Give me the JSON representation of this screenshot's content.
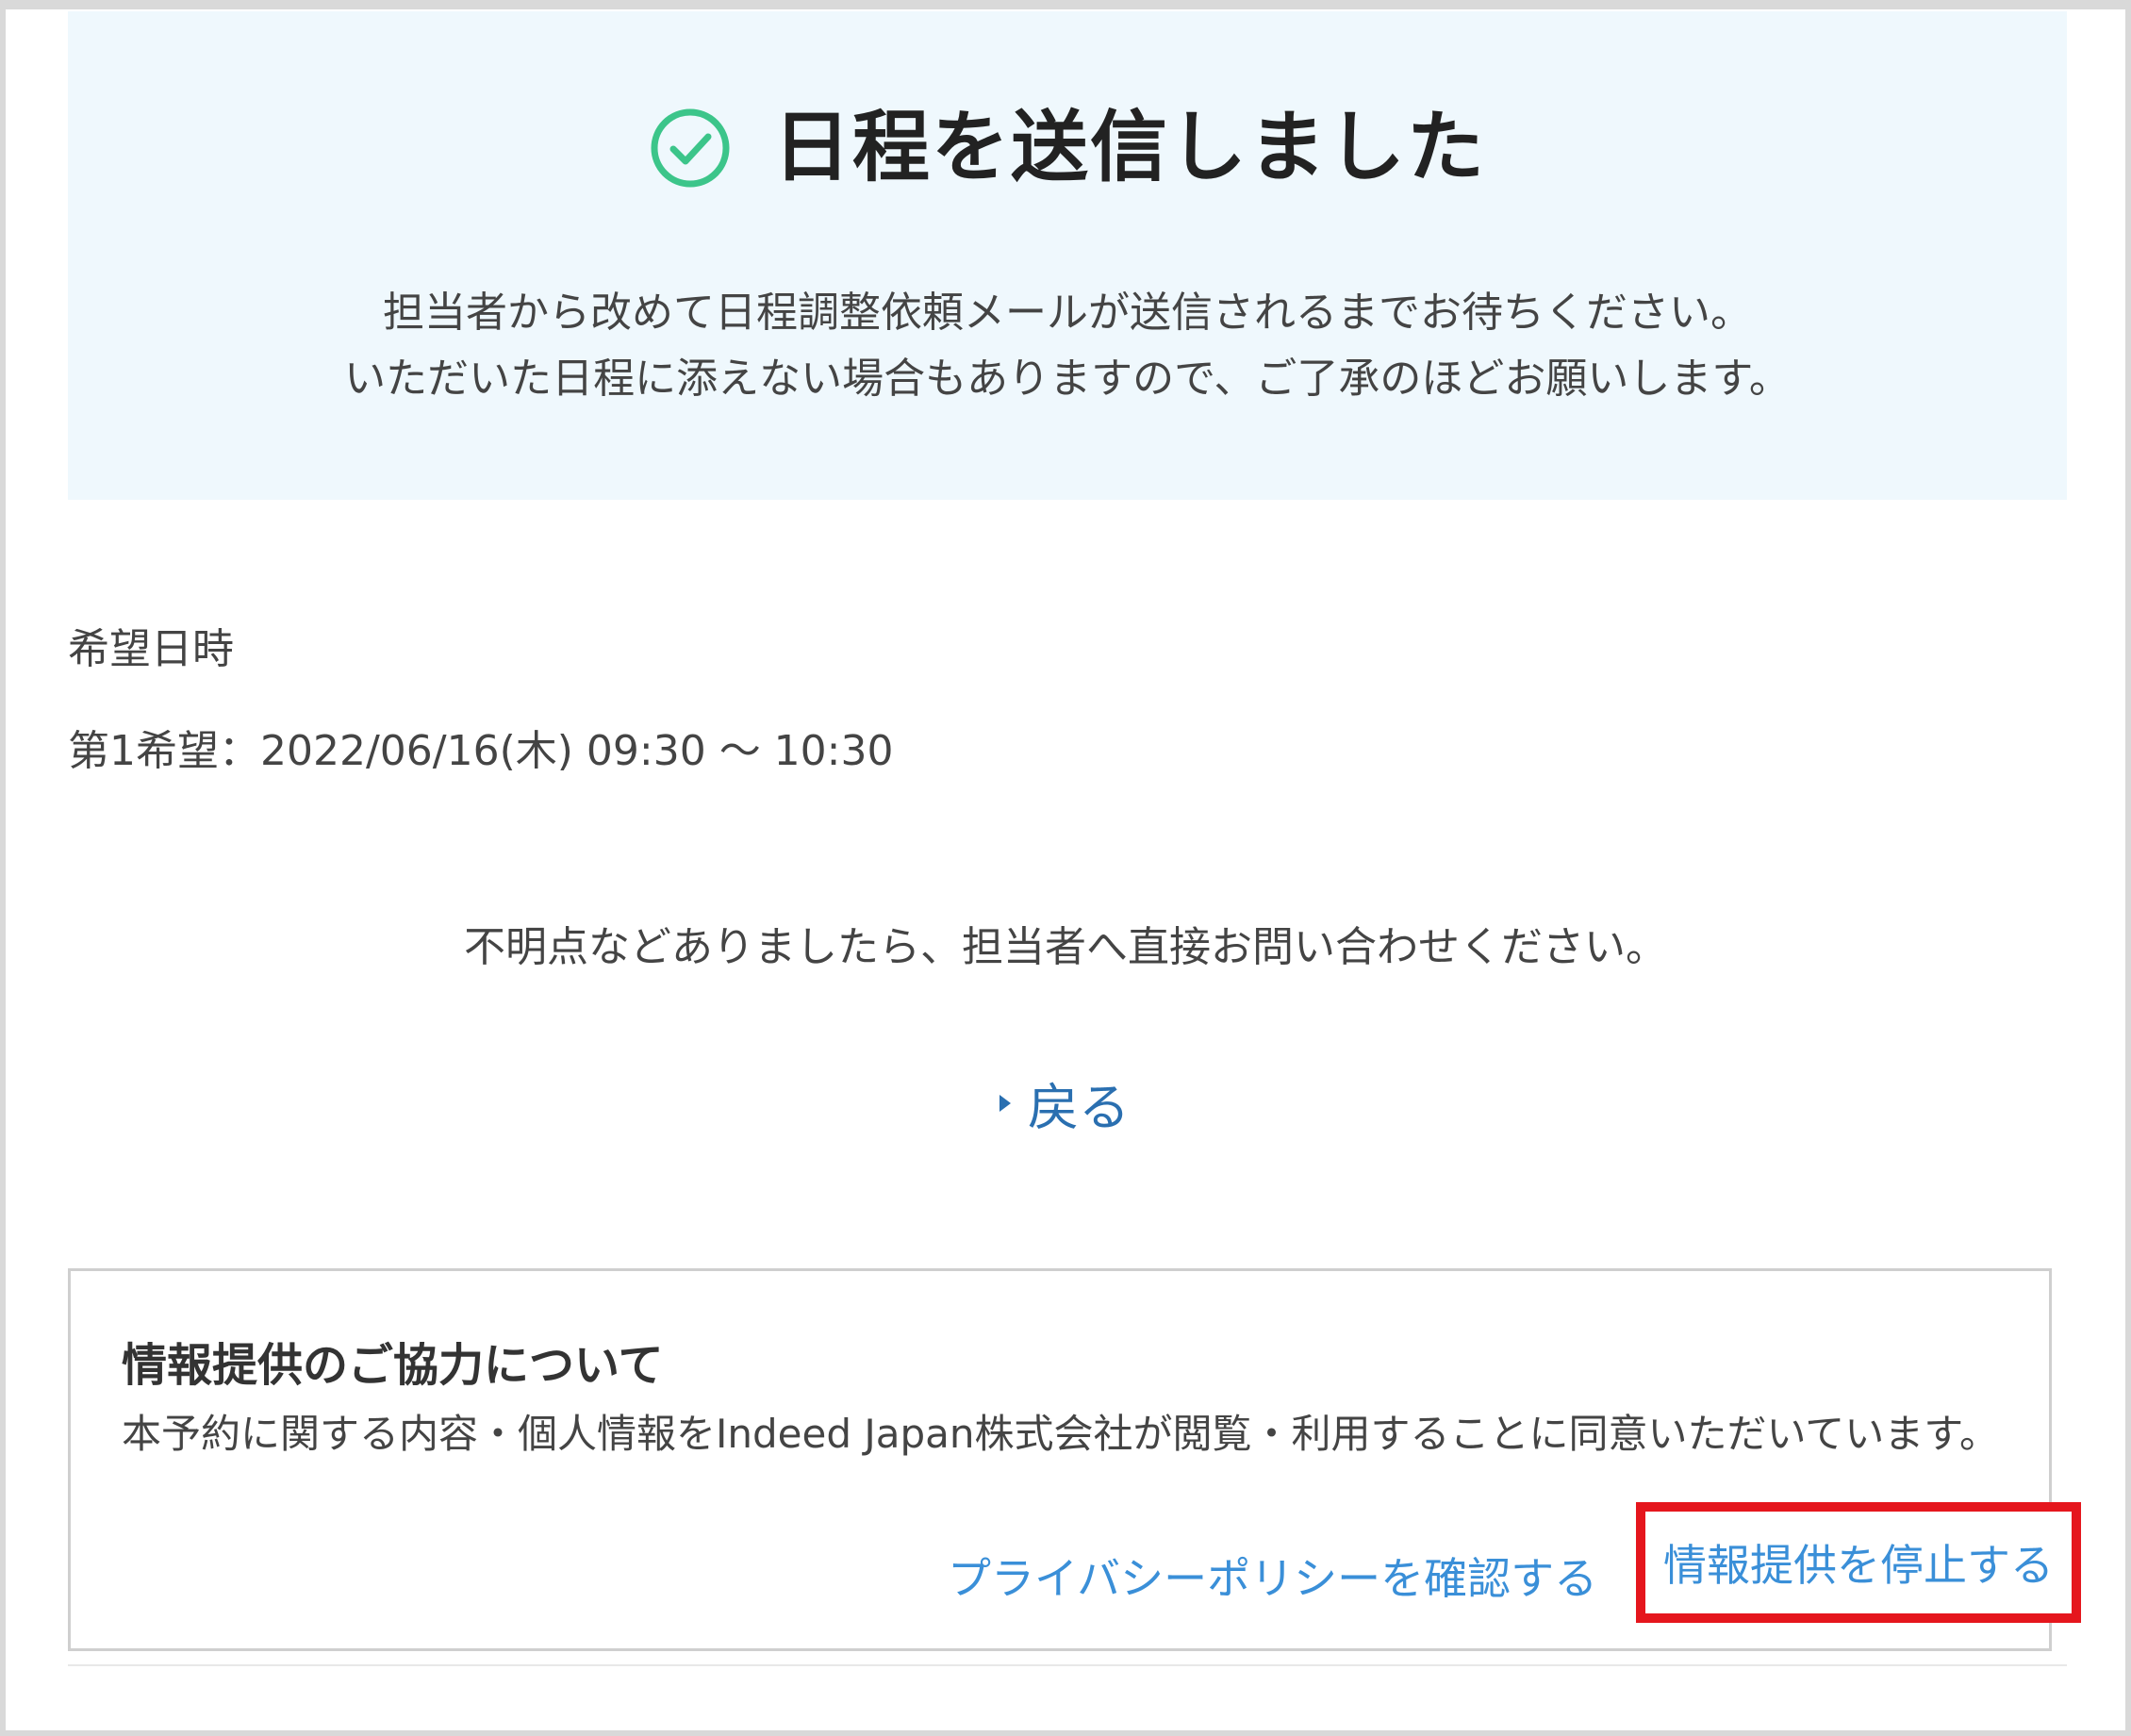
{
  "hero": {
    "title": "日程を送信しました",
    "message_line1": "担当者から改めて日程調整依頼メールが送信されるまでお待ちください。",
    "message_line2": "いただいた日程に添えない場合もありますので、ご了承のほどお願いします。",
    "icon": "check-circle-icon",
    "icon_color": "#3cc58a"
  },
  "schedule": {
    "label": "希望日時",
    "first_choice": "第1希望：2022/06/16(木) 09:30 ～ 10:30"
  },
  "inquiry_text": "不明点などありましたら、担当者へ直接お問い合わせください。",
  "back_link": {
    "label": "戻る",
    "color": "#2a6fb0"
  },
  "consent": {
    "title": "情報提供のご協力について",
    "body": "本予約に関する内容・個人情報をIndeed Japan株式会社が閲覧・利用することに同意いただいています。",
    "privacy_link": "プライバシーポリシーを確認する",
    "stop_link": "情報提供を停止する",
    "link_color": "#3a8fd8",
    "highlight_color": "#e5161d"
  }
}
